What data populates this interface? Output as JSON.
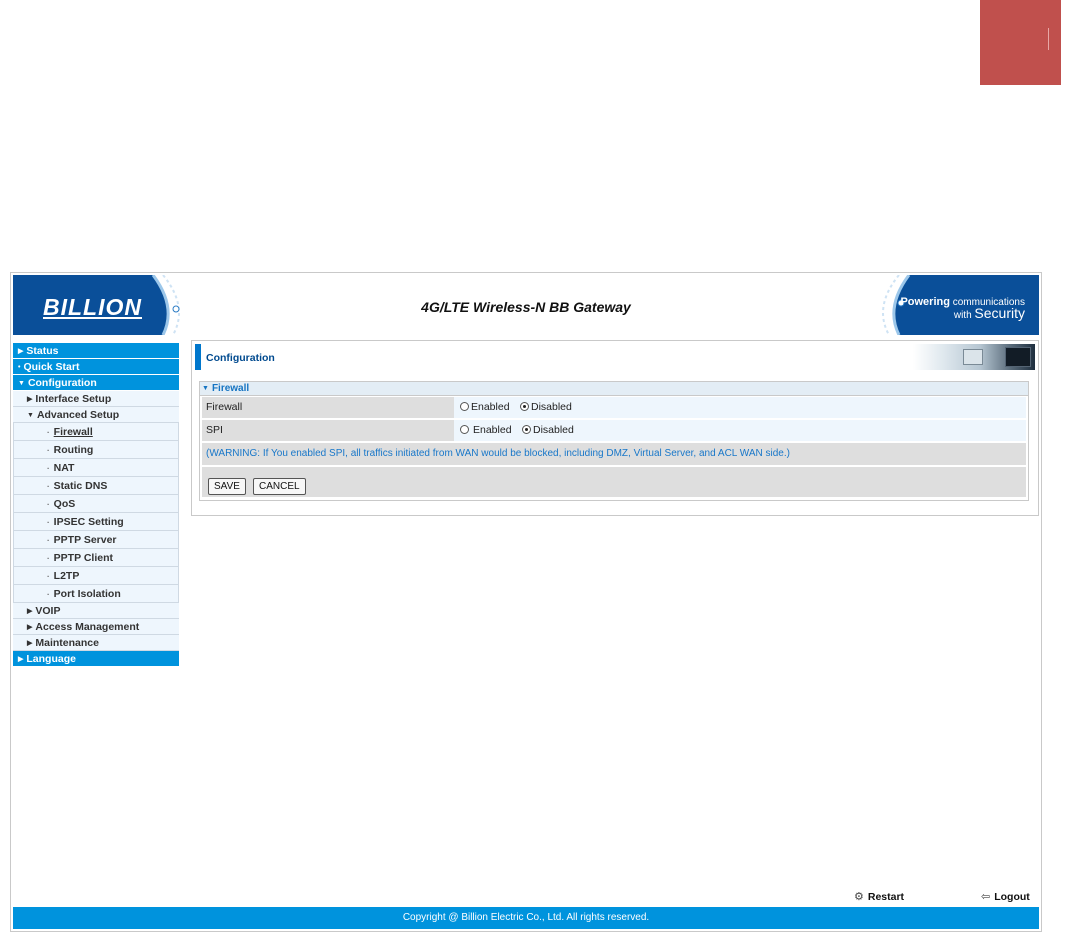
{
  "colors": {
    "accent": "#0093dd",
    "title_blue": "#004a8f",
    "corner_box": "#c0504d",
    "warning_text": "#1877c9"
  },
  "header": {
    "logo": "BILLION",
    "title": "4G/LTE Wireless-N BB Gateway",
    "tagline_bold": "Powering",
    "tagline_small": "communications",
    "tagline_with": "with",
    "tagline_security": "Security"
  },
  "sidebar": {
    "status": "Status",
    "quick_start": "Quick Start",
    "configuration": "Configuration",
    "interface_setup": "Interface Setup",
    "advanced_setup": "Advanced Setup",
    "advanced_items": [
      "Firewall",
      "Routing",
      "NAT",
      "Static DNS",
      "QoS",
      "IPSEC Setting",
      "PPTP Server",
      "PPTP Client",
      "L2TP",
      "Port Isolation"
    ],
    "voip": "VOIP",
    "access_management": "Access Management",
    "maintenance": "Maintenance",
    "language": "Language"
  },
  "content": {
    "section_title": "Configuration",
    "panel_title": "Firewall",
    "rows": [
      {
        "label": "Firewall",
        "enabled": "Enabled",
        "disabled": "Disabled",
        "selected": "Disabled"
      },
      {
        "label": "SPI",
        "enabled": "Enabled",
        "disabled": "Disabled",
        "selected": "Disabled"
      }
    ],
    "warning": "(WARNING: If You enabled SPI, all traffics initiated from WAN would be blocked, including DMZ, Virtual Server, and ACL WAN side.)",
    "save_label": "SAVE",
    "cancel_label": "CANCEL"
  },
  "footer": {
    "restart": "Restart",
    "logout": "Logout",
    "copyright": "Copyright @ Billion Electric Co., Ltd. All rights reserved."
  }
}
